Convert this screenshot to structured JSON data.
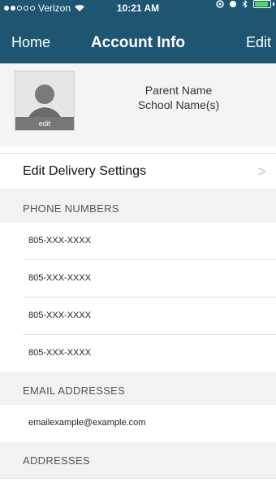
{
  "status_bar": {
    "carrier": "Verizon",
    "time": "10:21 AM",
    "battery_level": 0.9
  },
  "nav": {
    "left": "Home",
    "title": "Account Info",
    "right": "Edit"
  },
  "profile": {
    "avatar_edit_label": "edit",
    "name": "Parent Name",
    "school": "School Name(s)"
  },
  "delivery": {
    "label": "Edit Delivery Settings",
    "chevron": ">"
  },
  "sections": {
    "phones": "PHONE NUMBERS",
    "emails": "EMAIL ADDRESSES",
    "addresses": "ADDRESSES"
  },
  "phones": [
    "805-XXX-XXXX",
    "805-XXX-XXXX",
    "805-XXX-XXXX",
    "805-XXX-XXXX"
  ],
  "emails": [
    "emailexample@example.com"
  ],
  "colors": {
    "nav_background": "#1e5571",
    "section_background": "#f2f2f2"
  }
}
